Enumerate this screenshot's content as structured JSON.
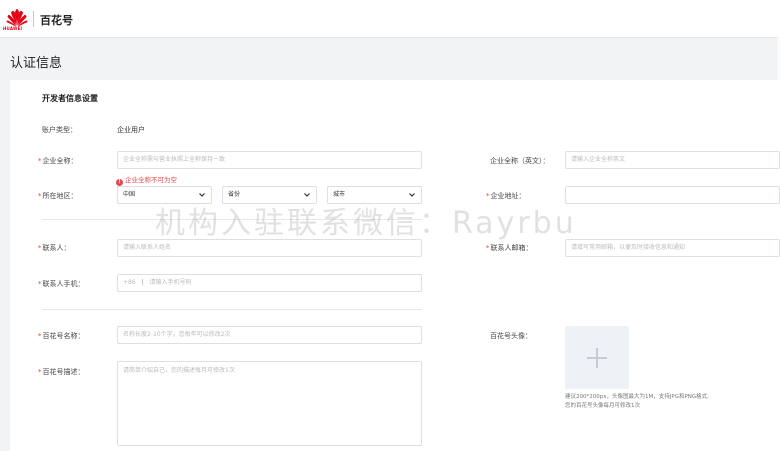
{
  "header": {
    "logo_text": "HUAWEI",
    "brand": "百花号"
  },
  "page_title": "认证信息",
  "section_title": "开发者信息设置",
  "account": {
    "label": "账户类型：",
    "value": "企业用户"
  },
  "company_name": {
    "label": "企业全称：",
    "placeholder": "企业全称需与营业执照上全称保持一致",
    "error": "企业全称不可为空"
  },
  "company_name_en": {
    "label": "企业全称（英文）：",
    "placeholder": "请输入企业全称英文"
  },
  "region": {
    "label": "所在地区：",
    "country": "中国",
    "province": "省份",
    "city": "城市"
  },
  "address": {
    "label": "企业地址："
  },
  "contact": {
    "label": "联系人：",
    "placeholder": "请输入联系人姓名"
  },
  "email": {
    "label": "联系人邮箱：",
    "placeholder": "请填写常用邮箱，以便及时接收信息和通知"
  },
  "phone": {
    "label": "联系人手机：",
    "prefix": "+86",
    "placeholder": "请输入手机号码"
  },
  "account_name": {
    "label": "百花号名称：",
    "placeholder": "名称长度2-10个字，您每年可以修改2次"
  },
  "avatar": {
    "label": "百花号头像：",
    "hint1": "建议200*200px，头像图最大为1M，支持JPG和PNG格式,",
    "hint2": "您的百花号头像每月可修改1次"
  },
  "description": {
    "label": "百花号描述：",
    "placeholder": "请简单介绍自己，您的描述每月可修改1次"
  },
  "watermark": "机构入驻联系微信：Rayrbu",
  "colors": {
    "required": "#e83c3c",
    "error": "#e5484d",
    "logo": "#e60012"
  }
}
